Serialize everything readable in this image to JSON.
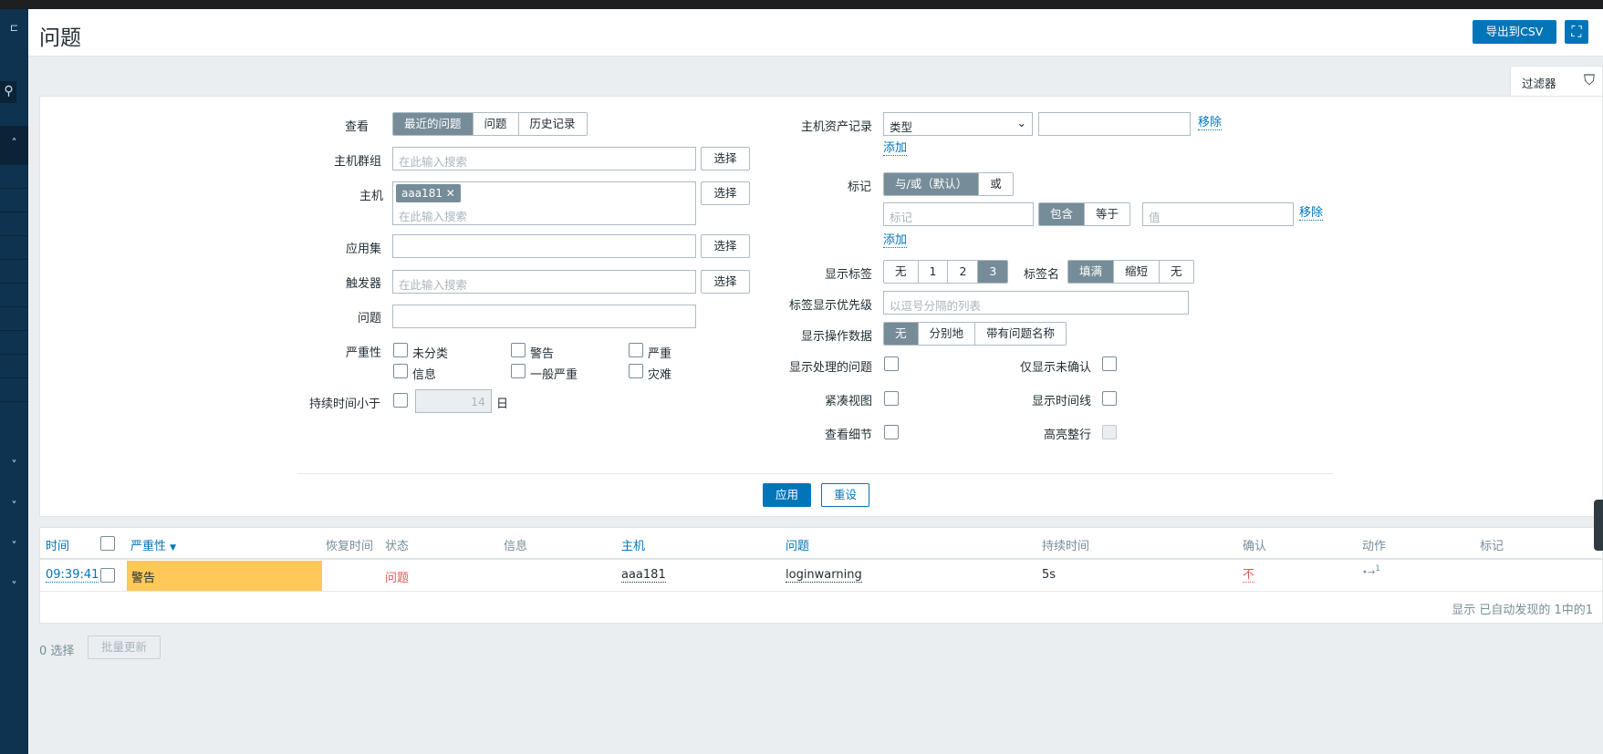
{
  "header": {
    "title": "问题",
    "export_label": "导出到CSV",
    "fullscreen_icon": "fullscreen-icon"
  },
  "filter_tab": {
    "label": "过滤器",
    "icon": "filter-icon"
  },
  "filter": {
    "view": {
      "label": "查看",
      "options": [
        "最近的问题",
        "问题",
        "历史记录"
      ],
      "selected": "最近的问题"
    },
    "host_groups": {
      "label": "主机群组",
      "placeholder": "在此输入搜索",
      "select": "选择"
    },
    "hosts": {
      "label": "主机",
      "chip": "aaa181",
      "placeholder": "在此输入搜索",
      "select": "选择"
    },
    "applications": {
      "label": "应用集",
      "value": "",
      "select": "选择"
    },
    "triggers": {
      "label": "触发器",
      "placeholder": "在此输入搜索",
      "select": "选择"
    },
    "problem": {
      "label": "问题",
      "value": ""
    },
    "severity": {
      "label": "严重性",
      "options": [
        "未分类",
        "警告",
        "严重",
        "信息",
        "一般严重",
        "灾难"
      ]
    },
    "age": {
      "label": "持续时间小于",
      "value": "14",
      "unit": "日"
    },
    "inventory": {
      "label": "主机资产记录",
      "select_value": "类型",
      "value": "",
      "remove": "移除",
      "add": "添加"
    },
    "tags": {
      "label": "标记",
      "eval_options": [
        "与/或（默认）",
        "或"
      ],
      "eval_selected": "与/或（默认）",
      "tag_placeholder": "标记",
      "operator_options": [
        "包含",
        "等于"
      ],
      "operator_selected": "包含",
      "value_placeholder": "值",
      "remove": "移除",
      "add": "添加"
    },
    "show_tags": {
      "label": "显示标签",
      "options": [
        "无",
        "1",
        "2",
        "3"
      ],
      "selected": "3"
    },
    "tag_name": {
      "label": "标签名",
      "options": [
        "填满",
        "缩短",
        "无"
      ],
      "selected": "填满"
    },
    "tag_priority": {
      "label": "标签显示优先级",
      "placeholder": "以逗号分隔的列表"
    },
    "show_opdata": {
      "label": "显示操作数据",
      "options": [
        "无",
        "分别地",
        "带有问题名称"
      ],
      "selected": "无"
    },
    "show_suppressed": {
      "label": "显示处理的问题"
    },
    "unacknowledged": {
      "label": "仅显示未确认"
    },
    "compact_view": {
      "label": "紧凑视图"
    },
    "show_timeline": {
      "label": "显示时间线"
    },
    "show_details": {
      "label": "查看细节"
    },
    "highlight_row": {
      "label": "高亮整行"
    },
    "apply": "应用",
    "reset": "重设"
  },
  "table": {
    "columns": [
      "时间",
      "严重性",
      "恢复时间",
      "状态",
      "信息",
      "主机",
      "问题",
      "持续时间",
      "确认",
      "动作",
      "标记"
    ],
    "rows": [
      {
        "time": "09:39:41",
        "severity": "警告",
        "recovery_time": "",
        "status": "问题",
        "info": "",
        "host": "aaa181",
        "problem": "loginwarning",
        "duration": "5s",
        "ack": "不",
        "actions": "1",
        "tags": ""
      }
    ],
    "footer": "显示 已自动发现的 1中的1"
  },
  "bottom": {
    "selected": "0 选择",
    "mass_update": "批量更新"
  },
  "colors": {
    "accent": "#0275b8",
    "warning": "#ffc859",
    "problem_red": "#e45959",
    "sidebar": "#0e3350"
  }
}
